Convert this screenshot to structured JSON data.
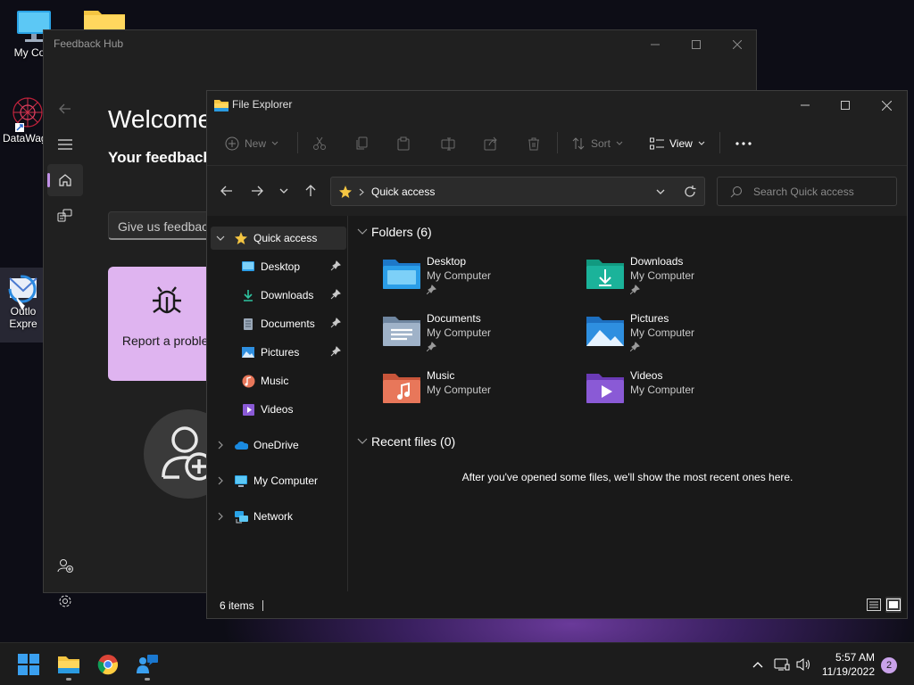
{
  "desktop": {
    "icons": [
      {
        "label": "My Com",
        "icon": "monitor-icon"
      },
      {
        "label": "",
        "icon": "folder-icon"
      },
      {
        "label": "DataWag",
        "icon": "datawag-icon"
      },
      {
        "label": "Outlo Expre",
        "icon": "outlook-express-icon"
      }
    ]
  },
  "feedback_hub": {
    "title": "Feedback Hub",
    "welcome": "Welcome",
    "subheading": "Your feedback",
    "input_placeholder": "Give us feedback",
    "card_label": "Report a problem",
    "nav": [
      "back-icon",
      "hamburger-icon",
      "home-icon",
      "feedback-icon",
      "add-user-icon",
      "settings-icon"
    ]
  },
  "explorer": {
    "title": "File Explorer",
    "toolbar": {
      "new_label": "New",
      "sort_label": "Sort",
      "view_label": "View",
      "more_label": "..."
    },
    "address": {
      "crumb": "Quick access"
    },
    "search": {
      "placeholder": "Search Quick access"
    },
    "sidebar": {
      "quick_access": "Quick access",
      "pinned": [
        {
          "label": "Desktop",
          "pinned": true
        },
        {
          "label": "Downloads",
          "pinned": true
        },
        {
          "label": "Documents",
          "pinned": true
        },
        {
          "label": "Pictures",
          "pinned": true
        },
        {
          "label": "Music",
          "pinned": false
        },
        {
          "label": "Videos",
          "pinned": false
        }
      ],
      "onedrive": "OneDrive",
      "my_computer": "My Computer",
      "network": "Network"
    },
    "folders_header": "Folders (6)",
    "folders": [
      {
        "name": "Desktop",
        "location": "My Computer",
        "pinned": true,
        "color": "#2b9ee8"
      },
      {
        "name": "Downloads",
        "location": "My Computer",
        "pinned": true,
        "color": "#1bb39a"
      },
      {
        "name": "Documents",
        "location": "My Computer",
        "pinned": true,
        "color": "#8aa4c0"
      },
      {
        "name": "Pictures",
        "location": "My Computer",
        "pinned": true,
        "color": "#2e8fe0"
      },
      {
        "name": "Music",
        "location": "My Computer",
        "pinned": false,
        "color": "#e8775a"
      },
      {
        "name": "Videos",
        "location": "My Computer",
        "pinned": false,
        "color": "#8a5ad6"
      }
    ],
    "recent_header": "Recent files (0)",
    "recent_empty": "After you've opened some files, we'll show the most recent ones here.",
    "status": {
      "count": "6 items"
    }
  },
  "taskbar": {
    "apps": [
      "start-icon",
      "file-explorer-icon",
      "chrome-icon",
      "feedback-hub-icon"
    ],
    "time": "5:57 AM",
    "date": "11/19/2022",
    "notifications": "2"
  }
}
